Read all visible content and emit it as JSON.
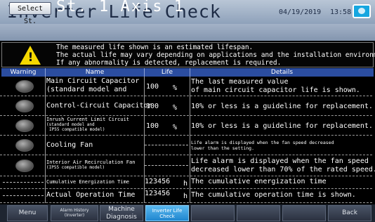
{
  "header": {
    "title": "Inverter Life Check",
    "date": "04/19/2019",
    "time": "13:58"
  },
  "station": {
    "select_label": "Select St.",
    "current": "St. 1 Axis 1"
  },
  "banner": {
    "line1": "The measured life shown is an estimated lifespan.",
    "line2": "The actual life may vary depending on applications and the installation environment.",
    "line3": "If any abnormality is detected, replacement is required."
  },
  "table": {
    "columns": [
      "Warning",
      "Name",
      "Life",
      "Details"
    ],
    "rows": [
      {
        "name": "Main Circuit Capacitor",
        "name2": "(standard model and",
        "life": "100",
        "unit": "%",
        "detail": "The last measured value",
        "detail2": "of main circuit capacitor life is shown."
      },
      {
        "name": "Control-Circuit Capacitor",
        "life": "100",
        "unit": "%",
        "detail": "10% or less is a guideline for replacement."
      },
      {
        "name": "Inrush Current Limit Circuit",
        "name2": "(standard model and",
        "name3": "IP55 compatible model)",
        "life": "100",
        "unit": "%",
        "detail": "10% or less is a guideline for replacement."
      },
      {
        "name": "Cooling Fan",
        "life": "",
        "detail": "Life alarm is displayed when the fan speed decreased",
        "detail2": "lower than the setting."
      },
      {
        "name": "Interior Air Recirculation Fan",
        "name2": "(IP55 compatible model)",
        "life": "",
        "detail": "Life alarm is displayed when the fan speed",
        "detail2": "decreased lower than 70% of the rated speed."
      },
      {
        "name": "Cumulative Energization Time",
        "life": "123456",
        "unit": "h",
        "detail": "The cumulative energization time"
      },
      {
        "name": "Actual Operation Time",
        "life": "123456",
        "unit": "h",
        "detail": "The cumulative operation time is shown."
      }
    ]
  },
  "footer": {
    "menu": "Menu",
    "alarm_history": "Alarm History",
    "alarm_history_sub": "(Inverter)",
    "machine_diag": "Machine",
    "machine_diag2": "Diagnosis",
    "inverter_life": "Inverter Life",
    "inverter_life_sub": "Check",
    "back": "Back"
  },
  "colors": {
    "header_bg": "#8ea1ba",
    "table_header": "#2b4da0",
    "active_tab": "#1f86cf",
    "warning_yellow": "#f5d800"
  }
}
